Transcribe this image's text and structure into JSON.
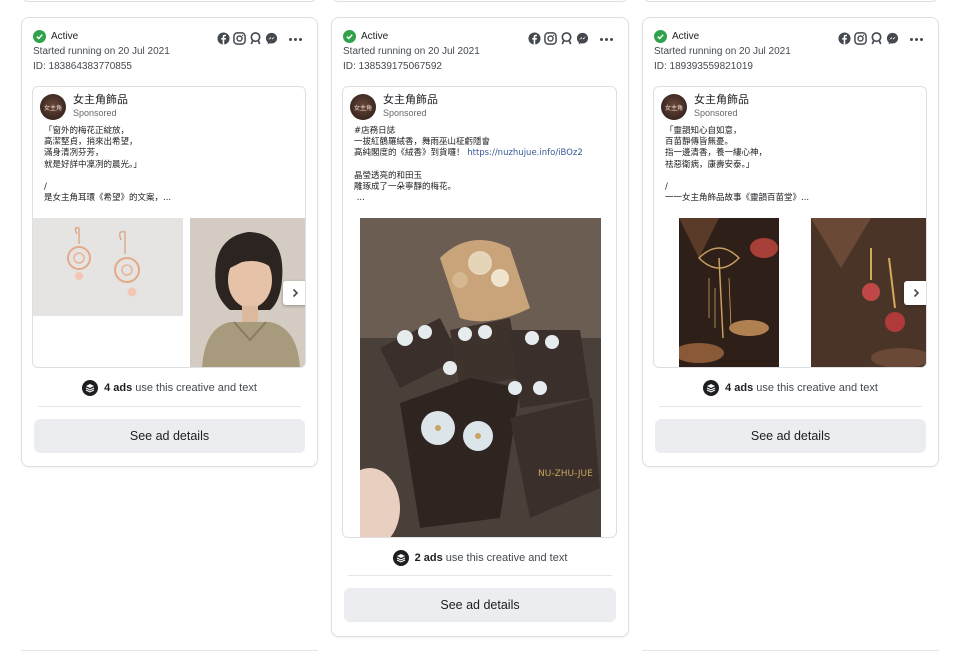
{
  "cards": [
    {
      "status": "Active",
      "started": "Started running on 20 Jul 2021",
      "id": "ID: 183864383770855",
      "advertiser": "女主角飾品",
      "sponsored": "Sponsored",
      "avatar_text": "女主角",
      "text": "「窗外的梅花正綻放，\n高潔堅貞，捎來出希望，\n滿身清冽芬芳，\n就是好詳中凜冽的晨光。」\n\n/\n是女主角耳環《希望》的文案，...",
      "uses_count": "4 ads",
      "uses_suffix": "use this creative and text",
      "button": "See ad details"
    },
    {
      "status": "Active",
      "started": "Started running on 20 Jul 2021",
      "id": "ID: 138539175067592",
      "advertiser": "女主角飾品",
      "sponsored": "Sponsored",
      "avatar_text": "女主角",
      "text_before_link": "#店務日誌\n一拔紅鶴羅絨香，舞雨巫山柾虧隱會\n高純閣度的《絨香》到貨囉！",
      "link": "https://nuzhujue.info/iBOz2",
      "text_after_link": "\n\n晶瑩透亮的和田玉\n雕琢成了一朵寧靜的梅花。\n ...",
      "uses_count": "2 ads",
      "uses_suffix": "use this creative and text",
      "button": "See ad details"
    },
    {
      "status": "Active",
      "started": "Started running on 20 Jul 2021",
      "id": "ID: 189393559821019",
      "advertiser": "女主角飾品",
      "sponsored": "Sponsored",
      "avatar_text": "女主角",
      "text": "「靈韻知心自如意，\n百苗靜傳皆無憂。\n指一邊清香，養一縷心神，\n祛惡衛病，康壽安泰。」\n\n/\n一一女主角飾品故事《靈韻百苗堂》...",
      "uses_count": "4 ads",
      "uses_suffix": "use this creative and text",
      "button": "See ad details"
    }
  ],
  "colors": {
    "active": "#31a24c",
    "link": "#385898",
    "button_bg": "#ebedf0",
    "border": "#dddfe2"
  },
  "icons": [
    "facebook-icon",
    "instagram-icon",
    "audience-network-icon",
    "messenger-icon",
    "more-icon",
    "check-icon",
    "stack-icon",
    "chevron-right-icon"
  ]
}
